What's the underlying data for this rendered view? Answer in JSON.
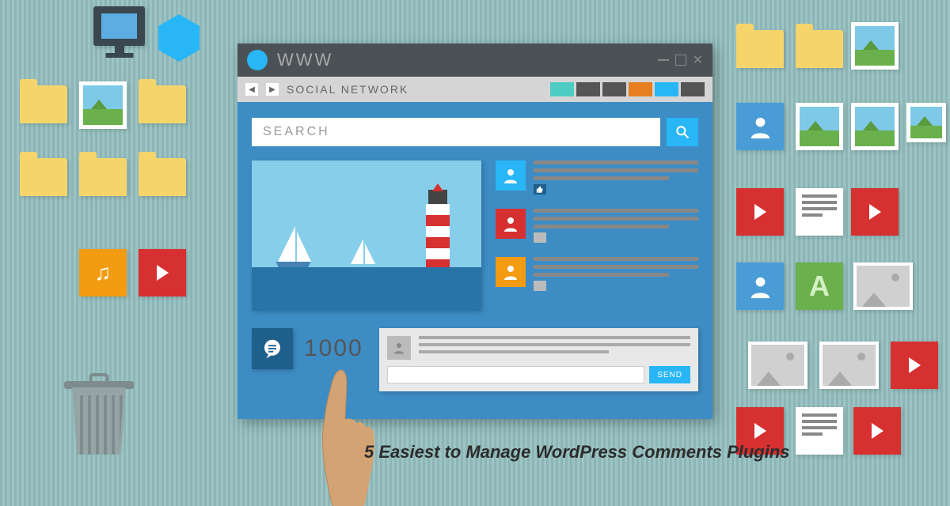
{
  "titlebar": {
    "label": "WWW"
  },
  "address_bar": {
    "label": "SOCIAL NETWORK"
  },
  "search": {
    "placeholder": "SEARCH"
  },
  "comment_count": "1000",
  "reply": {
    "send_label": "SEND"
  },
  "letter_tile": "A",
  "caption": "5 Easiest to Manage WordPress Comments Plugins",
  "addr_chips": [
    {
      "color": "#4ecdc4"
    },
    {
      "color": "#555"
    },
    {
      "color": "#555"
    },
    {
      "color": "#e67e22"
    },
    {
      "color": "#29b6f6"
    },
    {
      "color": "#555"
    }
  ],
  "feed": [
    {
      "avatar_bg": "#29b6f6",
      "meta_bg": "#1f5f8b",
      "meta_icon": "like"
    },
    {
      "avatar_bg": "#d63031",
      "meta_bg": "#bbb",
      "meta_icon": ""
    },
    {
      "avatar_bg": "#f39c12",
      "meta_bg": "#bbb",
      "meta_icon": ""
    }
  ]
}
